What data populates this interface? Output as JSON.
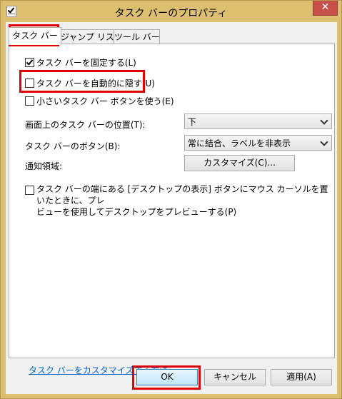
{
  "window": {
    "title": "タスク バーのプロパティ",
    "close_glyph": "✕"
  },
  "tabs": [
    {
      "label": "タスク バー",
      "active": true
    },
    {
      "label": "ジャンプ リスト",
      "active": false
    },
    {
      "label": "ツール バー",
      "active": false
    }
  ],
  "options": {
    "lock_taskbar": {
      "label": "タスク バーを固定する(L)",
      "checked": true
    },
    "auto_hide": {
      "label": "タスク バーを自動的に隠す(U)",
      "checked": false
    },
    "small_buttons": {
      "label": "小さいタスク バー ボタンを使う(E)",
      "checked": false
    },
    "peek_line1": "タスク バーの端にある [デスクトップの表示] ボタンにマウス カーソルを置いたときに、プレ",
    "peek_line2": "ビューを使用してデスクトップをプレビューする(P)",
    "peek_checked": false
  },
  "location": {
    "label": "画面上のタスク バーの位置(T):",
    "value": "下"
  },
  "buttons_setting": {
    "label": "タスク バーのボタン(B):",
    "value": "常に結合、ラベルを非表示"
  },
  "notification": {
    "label": "通知領域:",
    "button": "カスタマイズ(C)..."
  },
  "help_link": "タスク バーをカスタマイズする方法",
  "footer": {
    "ok": "OK",
    "cancel": "キャンセル",
    "apply": "適用(A)"
  },
  "colors": {
    "frame": "#dcbf6f",
    "highlight": "#e00000",
    "close": "#c7504b",
    "link": "#0066cc"
  }
}
